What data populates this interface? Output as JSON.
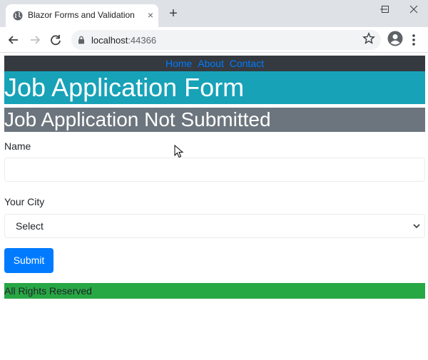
{
  "browser": {
    "tab_title": "Blazor Forms and Validation",
    "tab_close": "×",
    "new_tab": "+",
    "url_host": "localhost",
    "url_port": ":44366"
  },
  "nav": {
    "items": [
      {
        "label": "Home"
      },
      {
        "label": "About"
      },
      {
        "label": "Contact"
      }
    ]
  },
  "header": {
    "title": "Job Application Form"
  },
  "status": {
    "text": "Job Application Not Submitted"
  },
  "form": {
    "name_label": "Name",
    "name_value": "",
    "city_label": "Your City",
    "city_selected": "Select",
    "submit_label": "Submit"
  },
  "footer": {
    "text": "All Rights Reserved"
  },
  "colors": {
    "nav_bg": "#343a40",
    "link": "#007bff",
    "header_bg": "#17a2b8",
    "status_bg": "#6c757d",
    "button_bg": "#007bff",
    "footer_bg": "#28a745"
  }
}
